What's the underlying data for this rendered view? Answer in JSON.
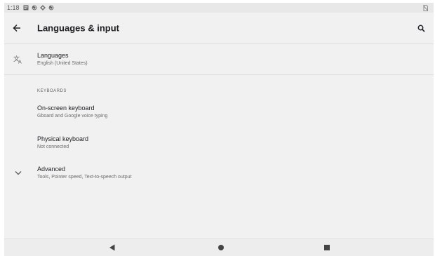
{
  "status_bar": {
    "time": "1:18",
    "icons": [
      "notification-icon",
      "sync-icon",
      "settings-icon",
      "sync-icon"
    ],
    "right_icon": "no-sim-icon"
  },
  "app_bar": {
    "back_icon": "arrow-back-icon",
    "title": "Languages & input",
    "search_icon": "search-icon"
  },
  "languages": {
    "icon": "translate-icon",
    "title": "Languages",
    "summary": "English (United States)"
  },
  "keyboards": {
    "category": "KEYBOARDS",
    "items": [
      {
        "title": "On-screen keyboard",
        "summary": "Gboard and Google voice typing"
      },
      {
        "title": "Physical keyboard",
        "summary": "Not connected"
      }
    ]
  },
  "advanced": {
    "icon": "chevron-down-icon",
    "title": "Advanced",
    "summary": "Tools, Pointer speed, Text-to-speech output"
  },
  "nav_bar": {
    "back_icon": "nav-back-icon",
    "home_icon": "nav-home-icon",
    "recents_icon": "nav-recents-icon"
  },
  "colors": {
    "background": "#f1f1f1",
    "text_primary": "#202124",
    "text_secondary": "#6b6b6b"
  }
}
